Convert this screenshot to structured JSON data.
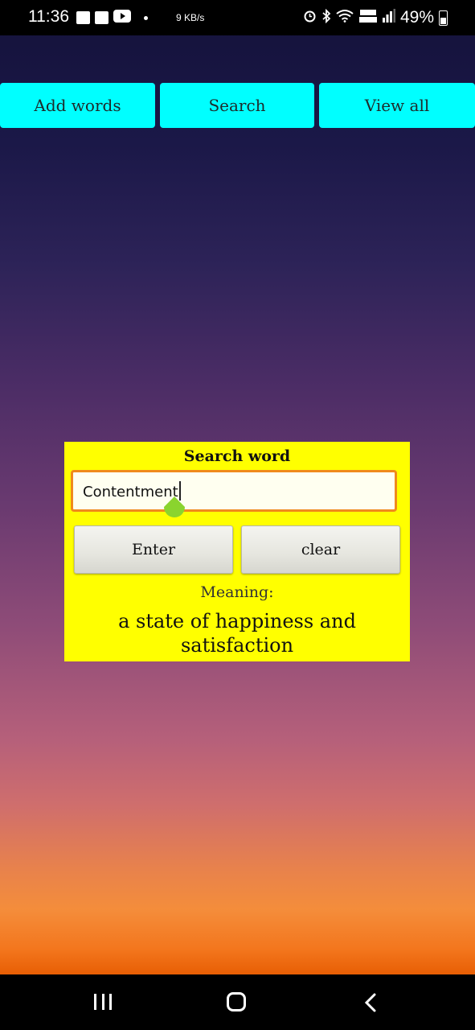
{
  "status_bar": {
    "time": "11:36",
    "network_speed": "9 KB/s",
    "battery": "49%",
    "left_icons": [
      "image-icon",
      "sim-check-icon",
      "youtube-icon",
      "dot-icon"
    ],
    "right_icons": [
      "alarm-icon",
      "bluetooth-icon",
      "wifi-icon",
      "volte-icon",
      "signal-icon",
      "battery-icon"
    ]
  },
  "top_nav": {
    "add_words": "Add words",
    "search": "Search",
    "view_all": "View all"
  },
  "panel": {
    "title": "Search word",
    "input_value": "Contentment",
    "enter_label": "Enter",
    "clear_label": "clear",
    "meaning_label": "Meaning:",
    "meaning_text": "a state of happiness and satisfaction"
  },
  "colors": {
    "nav_button_bg": "#00ffff",
    "panel_bg": "#ffff00",
    "input_border": "#f08a1c",
    "text_handle": "#8ad42e"
  },
  "system_nav": {
    "icons": [
      "recent-apps-icon",
      "home-icon",
      "back-icon"
    ]
  }
}
